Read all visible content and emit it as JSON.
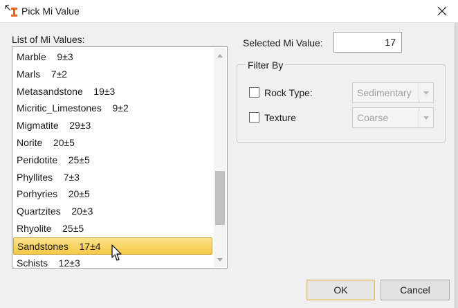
{
  "window": {
    "title": "Pick Mi Value",
    "icons": {
      "app": "app-icon",
      "close": "close-icon"
    }
  },
  "list": {
    "label": "List of Mi Values:",
    "items": [
      "Marble    9±3",
      "Marls    7±2",
      "Metasandstone    19±3",
      "Micritic_Limestones    9±2",
      "Migmatite    29±3",
      "Norite    20±5",
      "Peridotite    25±5",
      "Phyllites    7±3",
      "Porhyries    20±5",
      "Quartzites    20±3",
      "Rhyolite    25±5",
      "Sandstones    17±4",
      "Schists    12±3"
    ],
    "selected_index": 11
  },
  "selected": {
    "label": "Selected Mi Value:",
    "value": "17"
  },
  "filter": {
    "legend": "Filter By",
    "rock_type": {
      "label": "Rock Type:",
      "checked": false,
      "value": "Sedimentary"
    },
    "texture": {
      "label": "Texture",
      "checked": false,
      "value": "Coarse"
    }
  },
  "buttons": {
    "ok": "OK",
    "cancel": "Cancel"
  },
  "colors": {
    "selection_fill": "#f8d35e",
    "selection_border": "#c9a23a",
    "window_bg": "#f0f0f0"
  }
}
